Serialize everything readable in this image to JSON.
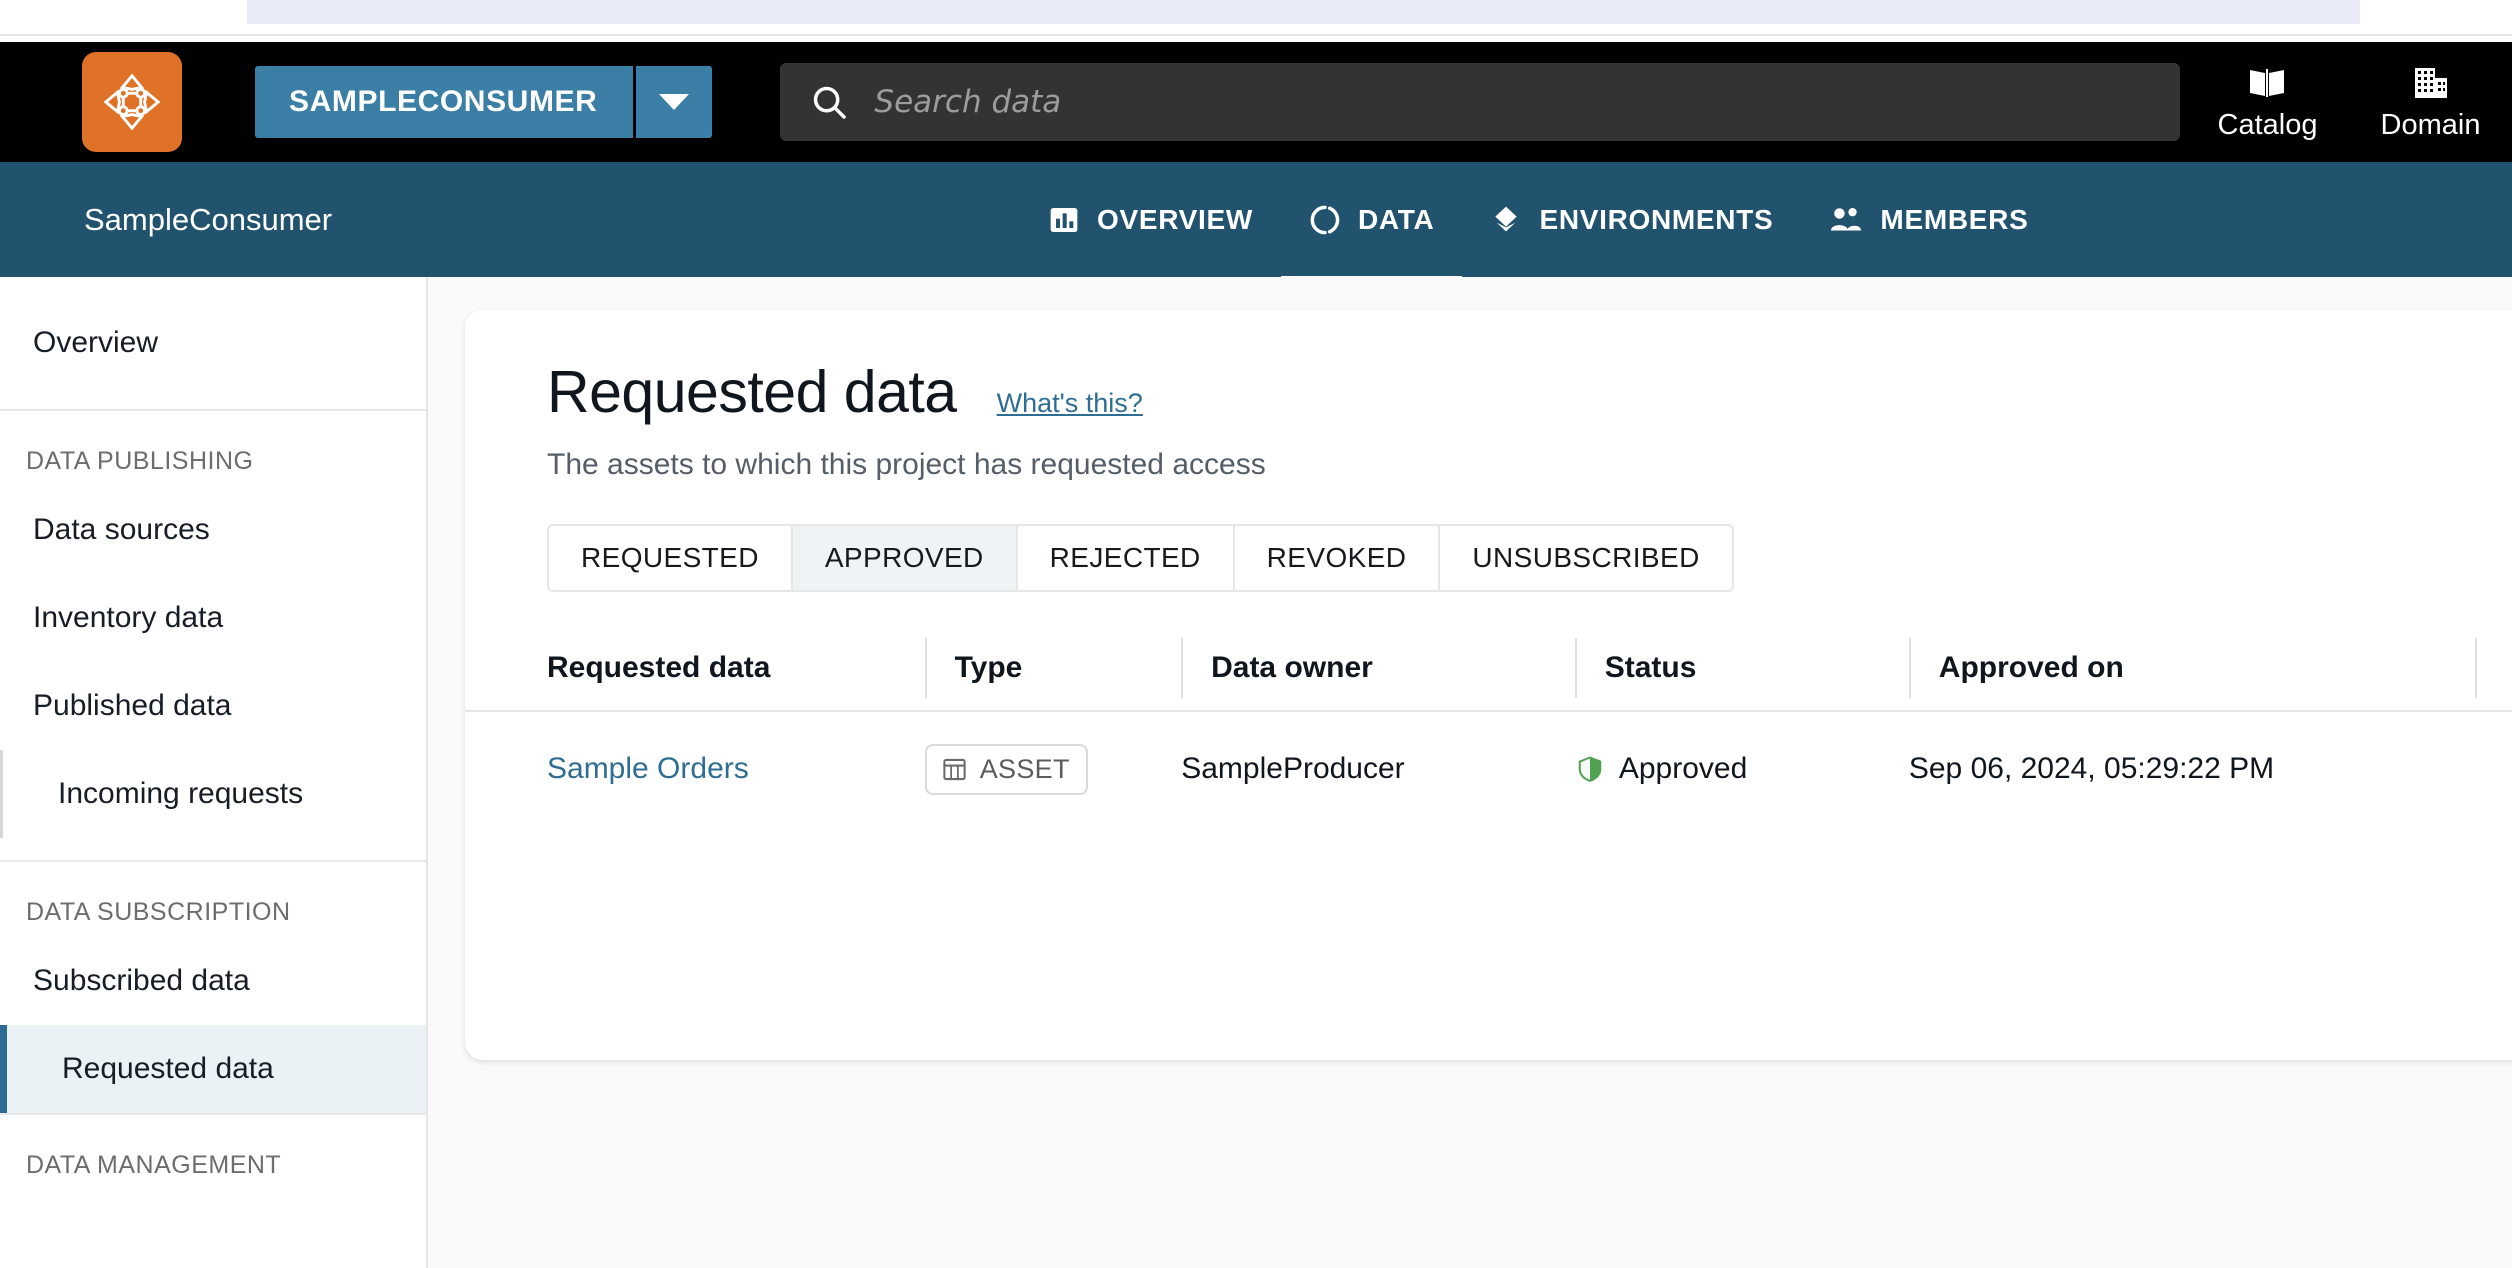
{
  "browser": {
    "tab_ghost": ""
  },
  "top_bar": {
    "logo_icon": "datazone-logo-icon",
    "project_switcher": {
      "label": "SAMPLECONSUMER",
      "caret_icon": "chevron-down-icon"
    },
    "search": {
      "icon": "search-icon",
      "placeholder": "Search data",
      "value": ""
    },
    "right_nav": [
      {
        "label": "Catalog",
        "icon": "book-icon"
      },
      {
        "label": "Domain",
        "icon": "building-icon"
      }
    ]
  },
  "project_nav": {
    "title": "SampleConsumer",
    "tabs": [
      {
        "label": "OVERVIEW",
        "icon": "bar-chart-icon",
        "active": false
      },
      {
        "label": "DATA",
        "icon": "circle-broken-icon",
        "active": true
      },
      {
        "label": "ENVIRONMENTS",
        "icon": "diamond-layers-icon",
        "active": false
      },
      {
        "label": "MEMBERS",
        "icon": "people-icon",
        "active": false
      }
    ]
  },
  "sidebar": {
    "groups": [
      {
        "label": "",
        "items": [
          {
            "label": "Overview",
            "selected": false,
            "sub": false
          }
        ]
      },
      {
        "label": "DATA PUBLISHING",
        "items": [
          {
            "label": "Data sources",
            "selected": false,
            "sub": false
          },
          {
            "label": "Inventory data",
            "selected": false,
            "sub": false
          },
          {
            "label": "Published data",
            "selected": false,
            "sub": false
          },
          {
            "label": "Incoming requests",
            "selected": false,
            "sub": true
          }
        ]
      },
      {
        "label": "DATA SUBSCRIPTION",
        "items": [
          {
            "label": "Subscribed data",
            "selected": false,
            "sub": false
          },
          {
            "label": "Requested data",
            "selected": true,
            "sub": true
          }
        ]
      },
      {
        "label": "DATA MANAGEMENT",
        "items": []
      }
    ]
  },
  "main": {
    "title": "Requested data",
    "whats_this_label": "What's this?",
    "subtitle": "The assets to which this project has requested access",
    "tabs": [
      {
        "label": "REQUESTED",
        "active": false
      },
      {
        "label": "APPROVED",
        "active": true
      },
      {
        "label": "REJECTED",
        "active": false
      },
      {
        "label": "REVOKED",
        "active": false
      },
      {
        "label": "UNSUBSCRIBED",
        "active": false
      }
    ],
    "table": {
      "columns": [
        "Requested data",
        "Type",
        "Data owner",
        "Status",
        "Approved on",
        ""
      ],
      "rows": [
        {
          "requested_data": "Sample Orders",
          "type": "ASSET",
          "type_icon": "table-icon",
          "data_owner": "SampleProducer",
          "status": "Approved",
          "status_icon": "shield-check-icon",
          "approved_on": "Sep 06, 2024, 05:29:22 PM"
        }
      ]
    }
  },
  "colors": {
    "brand_orange": "#df7227",
    "nav_blue": "#21526e",
    "switcher_blue": "#3c7fa6",
    "link_blue": "#2e6e93",
    "status_green": "#3a8c3f",
    "top_bar_black": "#000000",
    "page_bg": "#fafafa"
  }
}
